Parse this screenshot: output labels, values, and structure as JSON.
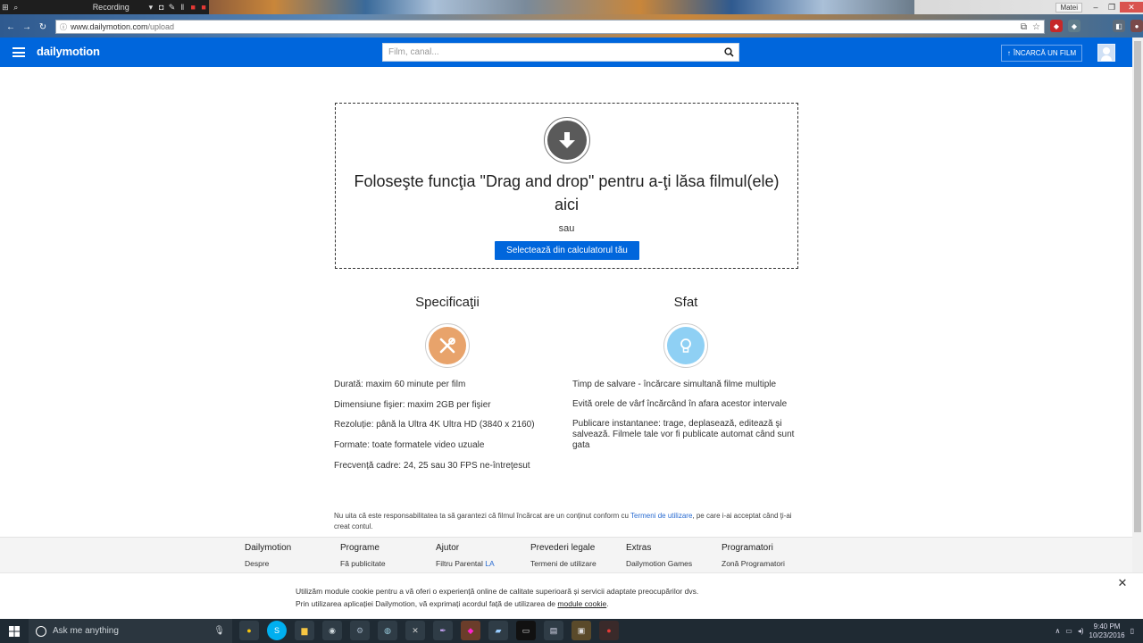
{
  "recorder": {
    "label": "Recording"
  },
  "window": {
    "user": "Matei"
  },
  "browser": {
    "url_host": "www.dailymotion.com",
    "url_path": "/upload"
  },
  "header": {
    "logo": "dailymotion",
    "search_placeholder": "Film, canal...",
    "upload_label": "ÎNCARCĂ UN FILM",
    "brand_color": "#0066dc"
  },
  "dropzone": {
    "title": "Foloseşte funcţia \"Drag and drop\" pentru a-ţi lăsa filmul(ele) aici",
    "or": "sau",
    "button_label": "Selectează din calculatorul tău"
  },
  "specs": {
    "title": "Specificaţii",
    "icon": "tools-icon",
    "items": [
      "Durată: maxim 60 minute per film",
      "Dimensiune fişier: maxim 2GB per fişier",
      "Rezoluție: până la Ultra 4K Ultra HD (3840 x 2160)",
      "Formate: toate formatele video uzuale",
      "Frecvență cadre: 24, 25 sau 30 FPS ne-întreţesut"
    ]
  },
  "tips": {
    "title": "Sfat",
    "icon": "lightbulb-icon",
    "items": [
      "Timp de salvare - încărcare simultană filme multiple",
      "Evită orele de vârf încărcând în afara acestor intervale",
      "Publicare instantanee: trage, deplasează, editează şi salvează. Filmele tale vor fi publicate automat când sunt gata"
    ]
  },
  "disclaimer": {
    "before": "Nu uita că este responsabilitatea ta să garantezi că filmul încărcat are un conținut conform cu ",
    "link": "Termeni de utilizare",
    "after": ", pe care i-ai acceptat când ţi-ai creat contul."
  },
  "footer": {
    "columns": [
      {
        "heading": "Dailymotion",
        "link": "Despre"
      },
      {
        "heading": "Programe",
        "link": "Fă publicitate"
      },
      {
        "heading": "Ajutor",
        "link": "Filtru Parental",
        "link_extra": "LA"
      },
      {
        "heading": "Prevederi legale",
        "link": "Termeni de utilizare"
      },
      {
        "heading": "Extras",
        "link": "Dailymotion Games"
      },
      {
        "heading": "Programatori",
        "link": "Zonă Programatori"
      }
    ]
  },
  "cookie": {
    "line1": "Utilizăm module cookie pentru a vă oferi o experiență online de calitate superioară și servicii adaptate preocupărilor dvs.",
    "line2_before": "Prin utilizarea aplicației Dailymotion, vă exprimați acordul față de utilizarea de ",
    "line2_link": "module cookie",
    "line2_after": "."
  },
  "taskbar": {
    "search_placeholder": "Ask me anything",
    "time": "9:40 PM",
    "date": "10/23/2016"
  }
}
